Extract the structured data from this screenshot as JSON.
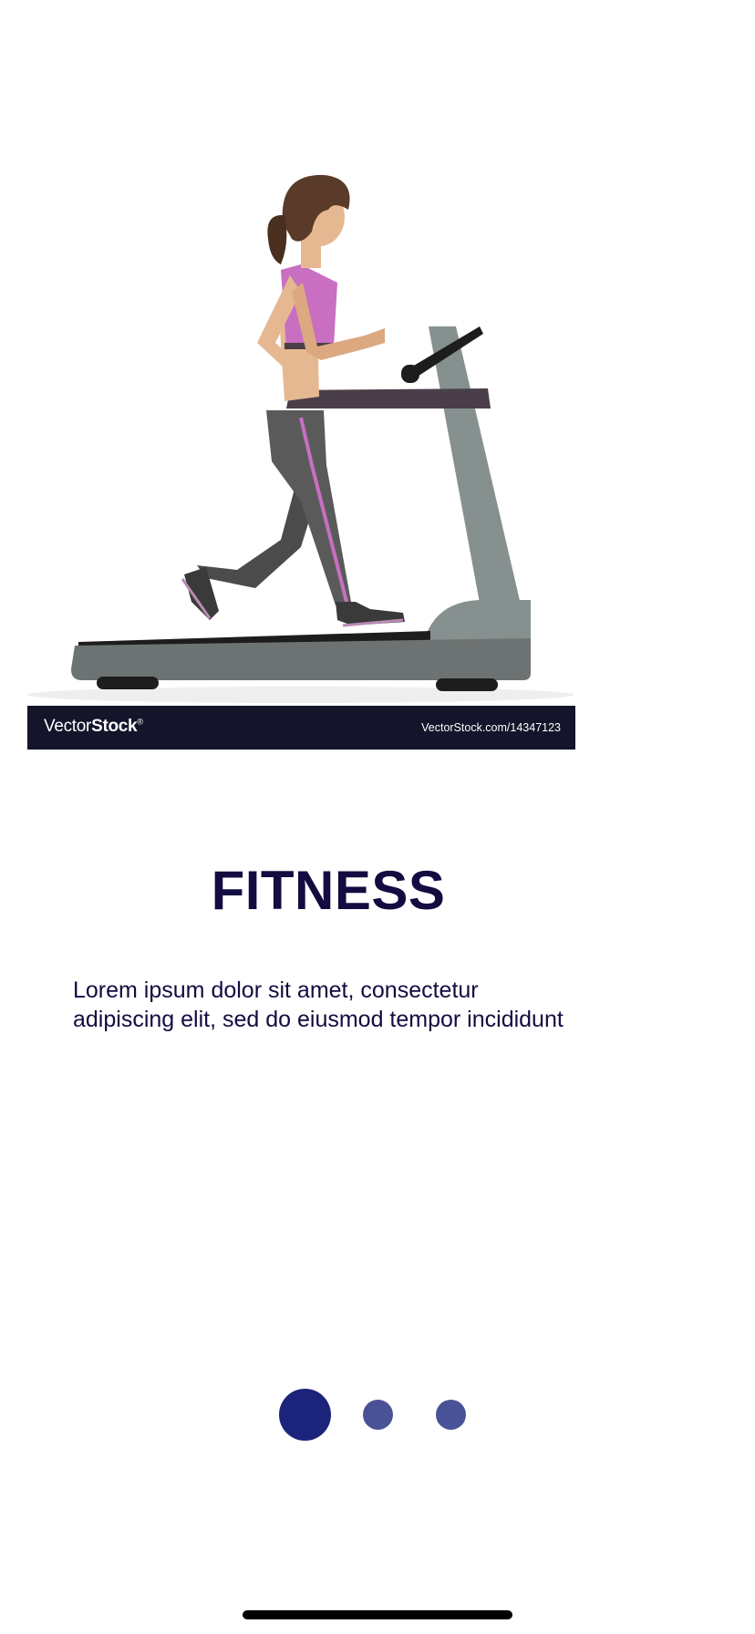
{
  "illustration": {
    "name": "woman-running-on-treadmill",
    "watermark_brand_light": "Vector",
    "watermark_brand_bold": "Stock",
    "watermark_registered": "®",
    "watermark_url": "VectorStock.com/14347123"
  },
  "title": "FITNESS",
  "description_lines": [
    "Lorem ipsum dolor sit amet, consectetur",
    "adipiscing elit, sed do eiusmod tempor incididunt"
  ],
  "pager": {
    "total": 3,
    "active_index": 0
  },
  "colors": {
    "title": "#130c40",
    "dot_active": "#1c237a",
    "dot_inactive": "#4a5297",
    "watermark_bar": "#14142a"
  }
}
